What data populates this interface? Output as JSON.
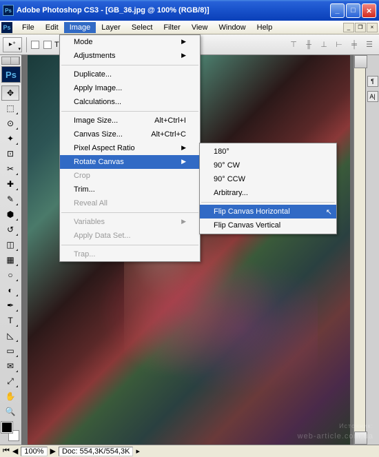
{
  "title": "Adobe Photoshop CS3 - [GB_36.jpg @ 100% (RGB/8)]",
  "menubar": [
    "File",
    "Edit",
    "Image",
    "Layer",
    "Select",
    "Filter",
    "View",
    "Window",
    "Help"
  ],
  "active_menu_index": 2,
  "options_bar": {
    "checkbox_label": "Transform Controls"
  },
  "image_menu": {
    "groups": [
      [
        {
          "label": "Mode",
          "arrow": true
        },
        {
          "label": "Adjustments",
          "arrow": true
        }
      ],
      [
        {
          "label": "Duplicate..."
        },
        {
          "label": "Apply Image..."
        },
        {
          "label": "Calculations..."
        }
      ],
      [
        {
          "label": "Image Size...",
          "shortcut": "Alt+Ctrl+I"
        },
        {
          "label": "Canvas Size...",
          "shortcut": "Alt+Ctrl+C"
        },
        {
          "label": "Pixel Aspect Ratio",
          "arrow": true
        },
        {
          "label": "Rotate Canvas",
          "arrow": true,
          "hover": true
        },
        {
          "label": "Crop",
          "disabled": true
        },
        {
          "label": "Trim..."
        },
        {
          "label": "Reveal All",
          "disabled": true
        }
      ],
      [
        {
          "label": "Variables",
          "arrow": true,
          "disabled": true
        },
        {
          "label": "Apply Data Set...",
          "disabled": true
        }
      ],
      [
        {
          "label": "Trap...",
          "disabled": true
        }
      ]
    ]
  },
  "rotate_submenu": [
    {
      "label": "180°"
    },
    {
      "label": "90° CW"
    },
    {
      "label": "90° CCW"
    },
    {
      "label": "Arbitrary..."
    },
    {
      "sep": true
    },
    {
      "label": "Flip Canvas Horizontal",
      "hover": true
    },
    {
      "label": "Flip Canvas Vertical"
    }
  ],
  "status": {
    "zoom": "100%",
    "doc": "Doc: 554,3K/554,3K"
  },
  "watermark": {
    "small": "Источник:",
    "text": "web-article.com.ua"
  },
  "tools": [
    "move",
    "marquee",
    "lasso",
    "wand",
    "crop",
    "slice",
    "heal",
    "brush",
    "stamp",
    "history",
    "eraser",
    "gradient",
    "blur",
    "dodge",
    "pen",
    "type",
    "path",
    "shape",
    "notes",
    "eyedrop",
    "hand",
    "zoom"
  ]
}
